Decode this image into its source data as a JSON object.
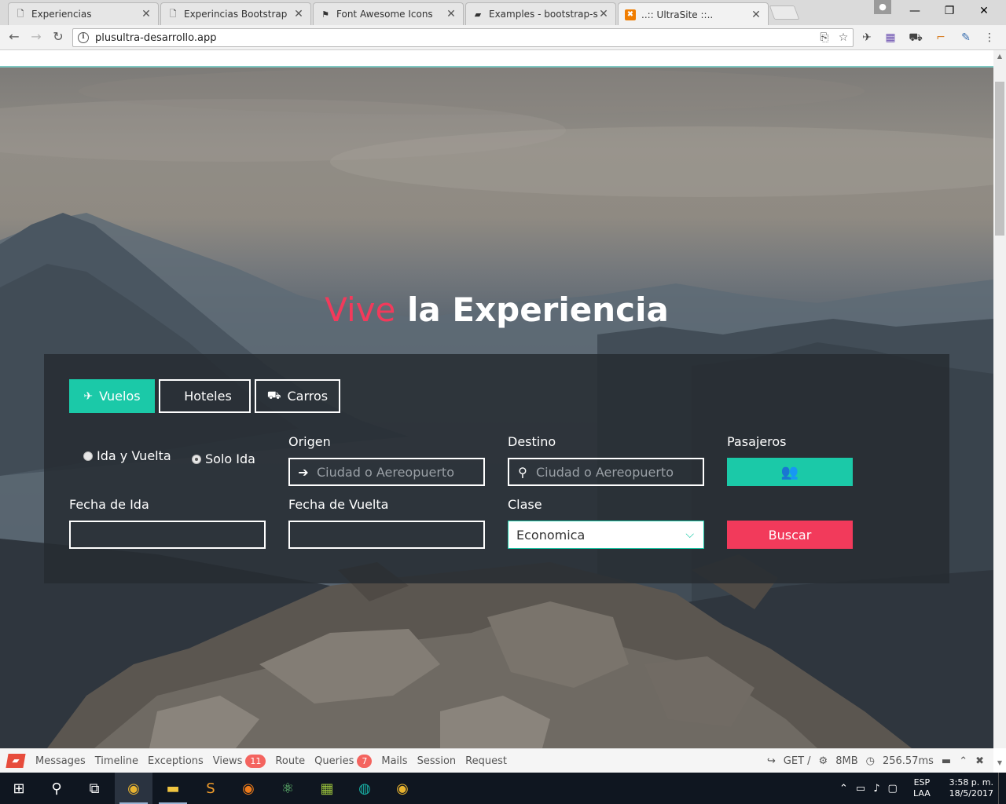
{
  "browser": {
    "tabs": [
      {
        "title": "Experiencias",
        "icon": "page-icon",
        "active": false
      },
      {
        "title": "Experincias Bootstrap",
        "icon": "page-icon",
        "active": false
      },
      {
        "title": "Font Awesome Icons",
        "icon": "flag-icon",
        "active": false
      },
      {
        "title": "Examples - bootstrap-sel",
        "icon": "book-icon",
        "active": false
      },
      {
        "title": "..:: UltraSite ::..",
        "icon": "xampp-icon",
        "active": true
      }
    ],
    "url": "plusultra-desarrollo.app",
    "close_glyph": "✕",
    "window_controls": {
      "minimize": "—",
      "maximize": "❐",
      "close": "✕"
    }
  },
  "hero": {
    "headline_accent": "Vive",
    "headline_rest": " la Experiencia"
  },
  "search": {
    "tabs": [
      {
        "label": "Vuelos",
        "icon": "plane-icon",
        "active": true
      },
      {
        "label": "Hoteles",
        "icon": "",
        "active": false
      },
      {
        "label": "Carros",
        "icon": "car-icon",
        "active": false
      }
    ],
    "trip_type": {
      "round_trip": "Ida y Vuelta",
      "one_way": "Solo Ida",
      "selected": "one_way"
    },
    "origin": {
      "label": "Origen",
      "placeholder": "Ciudad o Aereopuerto",
      "value": ""
    },
    "destination": {
      "label": "Destino",
      "placeholder": "Ciudad o Aereopuerto",
      "value": ""
    },
    "passengers": {
      "label": "Pasajeros"
    },
    "departure": {
      "label": "Fecha de Ida",
      "value": ""
    },
    "return": {
      "label": "Fecha de Vuelta",
      "value": ""
    },
    "class": {
      "label": "Clase",
      "value": "Economica"
    },
    "submit": "Buscar",
    "colors": {
      "accent": "#1bc9a8",
      "danger": "#f23a5b",
      "panel": "#262c32"
    }
  },
  "debugbar": {
    "tabs": [
      {
        "label": "Messages",
        "badge": ""
      },
      {
        "label": "Timeline",
        "badge": ""
      },
      {
        "label": "Exceptions",
        "badge": ""
      },
      {
        "label": "Views",
        "badge": "11"
      },
      {
        "label": "Route",
        "badge": ""
      },
      {
        "label": "Queries",
        "badge": "7"
      },
      {
        "label": "Mails",
        "badge": ""
      },
      {
        "label": "Session",
        "badge": ""
      },
      {
        "label": "Request",
        "badge": ""
      }
    ],
    "method": "GET /",
    "memory": "8MB",
    "time": "256.57ms"
  },
  "taskbar": {
    "language": "ESP",
    "layout": "LAA",
    "time": "3:58 p. m.",
    "date": "18/5/2017"
  }
}
